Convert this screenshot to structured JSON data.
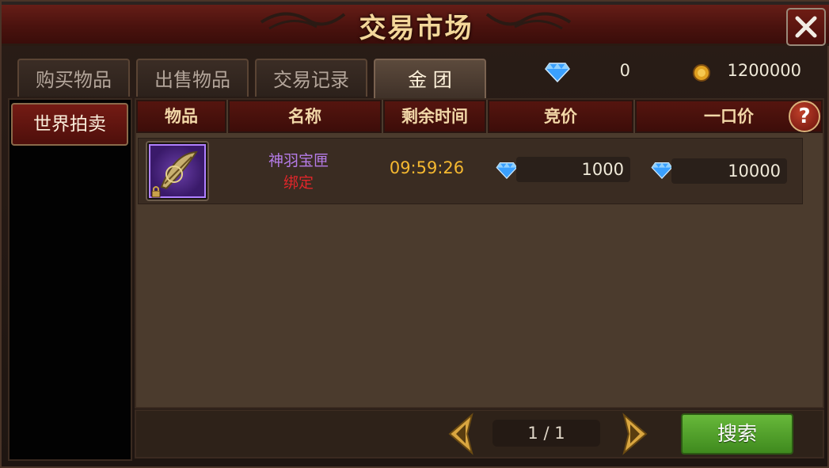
{
  "window": {
    "title": "交易市场"
  },
  "tabs": [
    {
      "label": "购买物品"
    },
    {
      "label": "出售物品"
    },
    {
      "label": "交易记录"
    },
    {
      "label": "金 团"
    }
  ],
  "currency": {
    "diamond": "0",
    "gold": "1200000"
  },
  "sidebar": {
    "category": "世界拍卖"
  },
  "table": {
    "headers": [
      "物品",
      "名称",
      "剩余时间",
      "竞价",
      "一口价"
    ],
    "help_label": "?",
    "rows": [
      {
        "name": "神羽宝匣",
        "bind": "绑定",
        "time_left": "09:59:26",
        "bid": "1000",
        "buyout": "10000"
      }
    ]
  },
  "pagination": {
    "page": "1 / 1"
  },
  "buttons": {
    "search": "搜索"
  },
  "colors": {
    "item_name": "#b57ce8",
    "bind": "#e0262a",
    "time": "#f5b830",
    "accent": "#5aa832"
  }
}
